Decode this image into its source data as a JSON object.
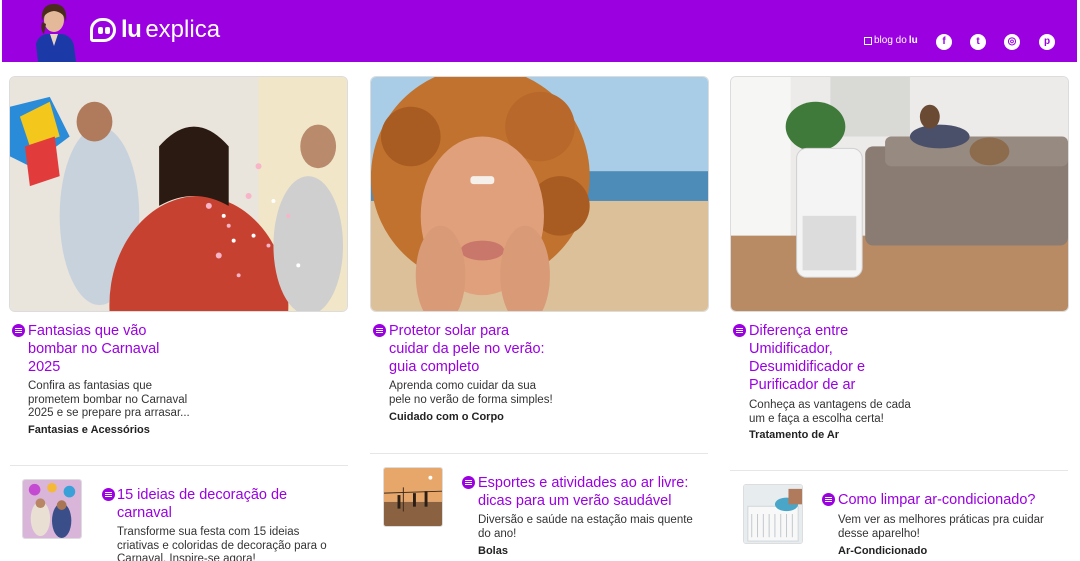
{
  "header": {
    "logo": {
      "part1": "lu",
      "part2": "explica"
    },
    "blog_link": {
      "prefix": "blog do",
      "brand": "lu"
    },
    "social": [
      {
        "icon": "facebook-icon",
        "glyph": "f"
      },
      {
        "icon": "twitter-icon",
        "glyph": "t"
      },
      {
        "icon": "instagram-icon",
        "glyph": "◎"
      },
      {
        "icon": "pinterest-icon",
        "glyph": "p"
      }
    ]
  },
  "colors": {
    "brand": "#9a00e0",
    "title": "#9a00e0",
    "text": "#333333"
  },
  "cards": [
    {
      "title_lines": [
        "Fantasias que vão",
        "bombar no Carnaval",
        "2025"
      ],
      "desc_lines": [
        "Confira as fantasias que",
        "prometem bombar no Carnaval",
        "2025 e se prepare pra arrasar..."
      ],
      "category": "Fantasias e Acessórios"
    },
    {
      "title_lines": [
        "Protetor solar para",
        "cuidar da pele no verão:",
        "guia completo"
      ],
      "desc_lines": [
        "Aprenda como cuidar da sua",
        "pele no verão de forma simples!"
      ],
      "category": "Cuidado com o Corpo"
    },
    {
      "title_lines": [
        "Diferença entre",
        "Umidificador,",
        "Desumidificador e",
        "Purificador de ar"
      ],
      "desc_lines": [
        "Conheça as vantagens de cada",
        "um e faça a escolha certa!"
      ],
      "category": "Tratamento de Ar"
    }
  ],
  "small_cards": [
    {
      "title_lines": [
        "15 ideias de decoração de",
        "carnaval"
      ],
      "desc_lines": [
        "Transforme sua festa com 15 ideias",
        "criativas e coloridas de decoração para o",
        "Carnaval. Inspire-se agora!"
      ],
      "category": ""
    },
    {
      "title_lines": [
        "Esportes e atividades ao ar livre:",
        "dicas para um verão saudável"
      ],
      "desc_lines": [
        "Diversão e saúde na estação mais quente",
        "do ano!"
      ],
      "category": "Bolas"
    },
    {
      "title_lines": [
        "Como limpar ar-condicionado?"
      ],
      "desc_lines": [
        "Vem ver as melhores práticas pra cuidar",
        "desse aparelho!"
      ],
      "category": "Ar-Condicionado"
    }
  ]
}
